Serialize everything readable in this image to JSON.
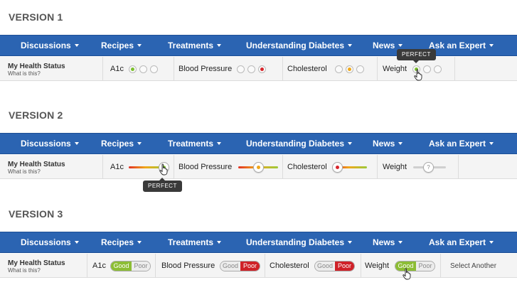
{
  "nav_items": [
    "Discussions",
    "Recipes",
    "Treatments",
    "Understanding Diabetes",
    "News",
    "Ask an Expert"
  ],
  "health_status": {
    "title": "My Health Status",
    "link": "What is this?"
  },
  "metrics": [
    "A1c",
    "Blood Pressure",
    "Cholesterol",
    "Weight"
  ],
  "version1": {
    "title": "VERSION 1",
    "tooltip": "PERFECT",
    "a1c": [
      "selected-green",
      "empty",
      "empty"
    ],
    "blood_pressure": [
      "empty",
      "empty",
      "selected-red"
    ],
    "cholesterol": [
      "empty",
      "selected-orange",
      "empty"
    ],
    "weight": [
      "selected-green",
      "empty",
      "empty"
    ]
  },
  "version2": {
    "title": "VERSION 2",
    "tooltip": "PERFECT",
    "a1c_level": 0.95,
    "blood_pressure_level": 0.5,
    "cholesterol_level": 0.08,
    "weight_level": "?"
  },
  "version3": {
    "title": "VERSION 3",
    "good_label": "Good",
    "poor_label": "Poor",
    "a1c": "Good",
    "blood_pressure": "Poor",
    "cholesterol": "Poor",
    "weight": "Good",
    "select_another": "Select Another"
  },
  "colors": {
    "nav_blue": "#2b64b2",
    "green": "#7cc02e",
    "orange": "#f0a81a",
    "red": "#d8252b",
    "toggle_green": "#8cbd34",
    "toggle_red": "#cf2128"
  }
}
